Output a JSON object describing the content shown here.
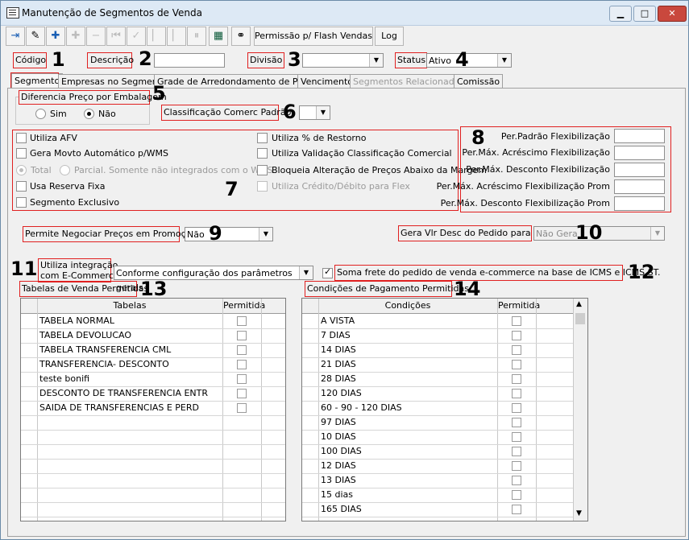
{
  "window": {
    "title": "Manutenção de Segmentos de Venda",
    "min": "▁",
    "max": "□",
    "close": "✕"
  },
  "toolbar": {
    "permissao_label": "Permissão p/ Flash Vendas",
    "log_label": "Log"
  },
  "header": {
    "codigo_label": "Código",
    "descricao_label": "Descrição",
    "divisao_label": "Divisão",
    "status_label": "Status",
    "status_value": "Ativo"
  },
  "annotations": {
    "n1": "1",
    "n2": "2",
    "n3": "3",
    "n4": "4",
    "n5": "5",
    "n6": "6",
    "n7": "7",
    "n8": "8",
    "n9": "9",
    "n10": "10",
    "n11": "11",
    "n12": "12",
    "n13": "13",
    "n14": "14"
  },
  "tabs": [
    "Segmento",
    "Empresas no Segmento",
    "Grade de Arredondamento de Preço",
    "Vencimento",
    "Segmentos Relacionados",
    "Comissão"
  ],
  "segmento": {
    "diferencia_label": "Diferencia Preço por Embalagem",
    "sim_label": "Sim",
    "nao_label": "Não",
    "classificacao_label": "Classificação Comerc Padrão",
    "left_checks": [
      "Utiliza AFV",
      "Gera Movto Automático p/WMS"
    ],
    "total_label": "Total",
    "parcial_label": "Parcial. Somente não integrados com o WMS",
    "usa_reserva_label": "Usa Reserva Fixa",
    "segmento_exclusivo_label": "Segmento Exclusivo",
    "right_checks": [
      "Utiliza % de Restorno",
      "Utiliza Validação Classificação Comercial",
      "Bloqueia Alteração de Preços Abaixo da Margem"
    ],
    "credito_label": "Utiliza Crédito/Débito para Flex",
    "flex_labels": [
      "Per.Padrão Flexibilização",
      "Per.Máx. Acréscimo Flexibilização",
      "Per.Máx. Desconto Flexibilização",
      "Per.Máx. Acréscimo Flexibilização Prom",
      "Per.Máx. Desconto Flexibilização Prom"
    ],
    "promocao_label": "Permite Negociar Preços em Promoção",
    "promocao_value": "Não",
    "gera_vlr_label": "Gera Vlr Desc do Pedido para NF",
    "gera_vlr_value": "Não Gera",
    "ecommerce_label_1": "Utiliza integração",
    "ecommerce_label_2": "com E-Commerce",
    "ecommerce_value": "Conforme configuração dos parâmetros gerais",
    "soma_frete_label": "Soma frete do pedido de venda e-commerce na base de ICMS e ICMS ST."
  },
  "tabelas": {
    "title": "Tabelas de Venda Permitidas",
    "col1": "Tabelas",
    "col2": "Permitida",
    "rows": [
      "TABELA NORMAL",
      "TABELA DEVOLUCAO",
      "TABELA TRANSFERENCIA CML",
      "TRANSFERENCIA- DESCONTO",
      "teste bonifi",
      "DESCONTO DE TRANSFERENCIA ENTR",
      "SAIDA DE TRANSFERENCIAS E PERD"
    ]
  },
  "condicoes": {
    "title": "Condições de Pagamento Permitidas",
    "col1": "Condições",
    "col2": "Permitida",
    "rows": [
      "A VISTA",
      "7 DIAS",
      "14 DIAS",
      "21 DIAS",
      "28 DIAS",
      "120 DIAS",
      "60 - 90 - 120 DIAS",
      "97 DIAS",
      "10 DIAS",
      "100 DIAS",
      "12 DIAS",
      "13 DIAS",
      "15 dias",
      "165 DIAS"
    ]
  }
}
